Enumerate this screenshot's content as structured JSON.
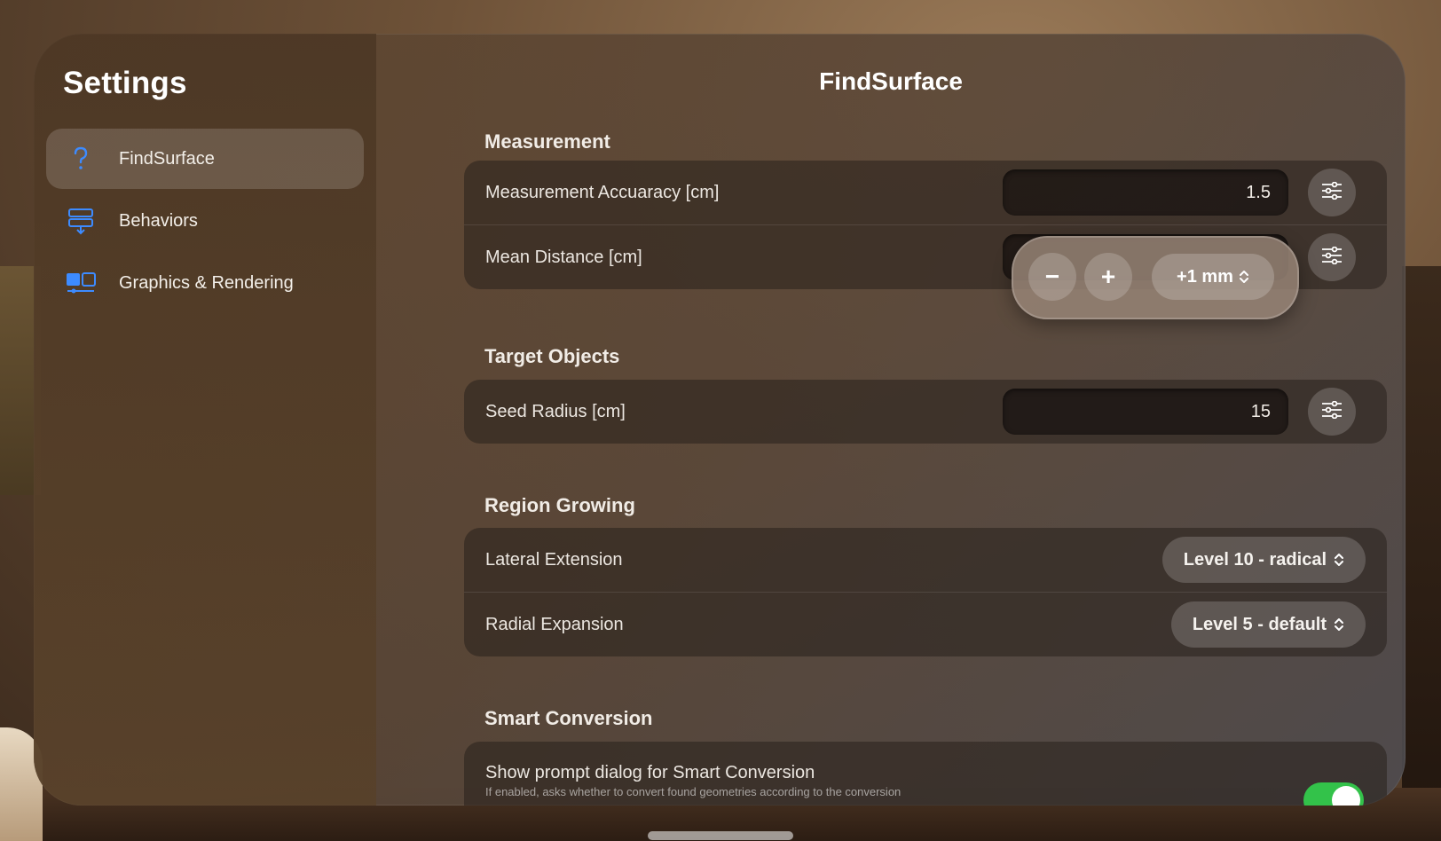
{
  "sidebar": {
    "title": "Settings",
    "items": [
      {
        "label": "FindSurface",
        "icon": "question-mark-icon",
        "selected": true
      },
      {
        "label": "Behaviors",
        "icon": "behaviors-icon",
        "selected": false
      },
      {
        "label": "Graphics & Rendering",
        "icon": "graphics-icon",
        "selected": false
      }
    ]
  },
  "main": {
    "title": "FindSurface",
    "sections": {
      "measurement": {
        "title": "Measurement",
        "rows": [
          {
            "label": "Measurement Accuaracy [cm]",
            "value": "1.5"
          },
          {
            "label": "Mean Distance [cm]",
            "value": ""
          }
        ]
      },
      "target_objects": {
        "title": "Target Objects",
        "rows": [
          {
            "label": "Seed Radius [cm]",
            "value": "15"
          }
        ]
      },
      "region_growing": {
        "title": "Region Growing",
        "rows": [
          {
            "label": "Lateral Extension",
            "value": "Level 10 - radical"
          },
          {
            "label": "Radial Expansion",
            "value": "Level 5 - default"
          }
        ]
      },
      "smart_conversion": {
        "title": "Smart Conversion",
        "rows": [
          {
            "label": "Show prompt dialog for Smart Conversion",
            "sublabel": "If enabled, asks whether to convert found geometries according to the conversion",
            "toggle_on": true
          }
        ]
      }
    },
    "stepper_popover": {
      "minus": "−",
      "plus": "+",
      "increment": "+1 mm"
    }
  },
  "colors": {
    "accent": "#3d8bff",
    "toggle_on": "#33c24a"
  }
}
